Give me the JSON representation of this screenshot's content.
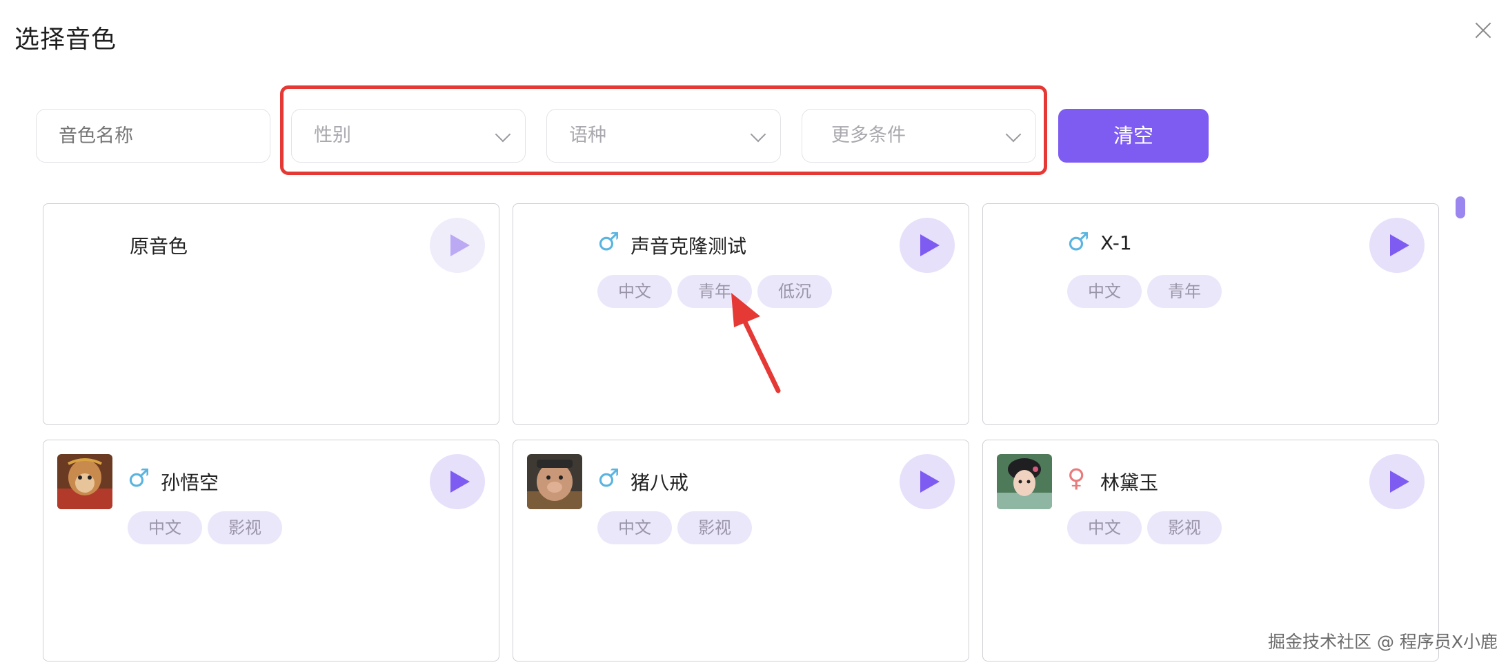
{
  "dialog": {
    "title": "选择音色"
  },
  "filters": {
    "name_placeholder": "音色名称",
    "gender_placeholder": "性别",
    "language_placeholder": "语种",
    "more_placeholder": "更多条件",
    "clear_label": "清空"
  },
  "cards": [
    {
      "name": "原音色",
      "gender": "",
      "tags": []
    },
    {
      "name": "声音克隆测试",
      "gender": "♂",
      "tags": [
        "中文",
        "青年",
        "低沉"
      ]
    },
    {
      "name": "X-1",
      "gender": "♂",
      "tags": [
        "中文",
        "青年"
      ]
    },
    {
      "name": "孙悟空",
      "gender": "♂",
      "tags": [
        "中文",
        "影视"
      ]
    },
    {
      "name": "猪八戒",
      "gender": "♂",
      "tags": [
        "中文",
        "影视"
      ]
    },
    {
      "name": "林黛玉",
      "gender": "♀",
      "tags": [
        "中文",
        "影视"
      ]
    }
  ],
  "watermark": "掘金技术社区 @ 程序员X小鹿",
  "colors": {
    "accent": "#7e5cf2",
    "highlight": "#e53935",
    "male": "#5ab4e0",
    "female": "#e87b7b"
  },
  "icons": {
    "close": "close-icon",
    "play": "play-icon",
    "male": "male-icon",
    "female": "female-icon"
  }
}
